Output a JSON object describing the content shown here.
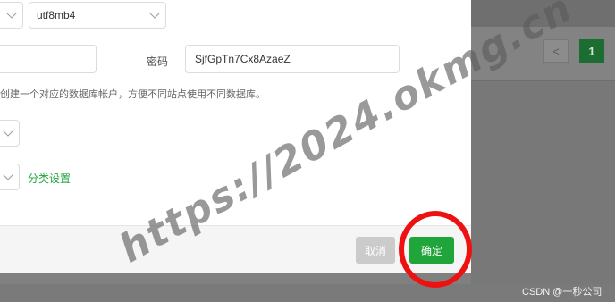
{
  "form": {
    "charset_value": "utf8mb4",
    "password_label": "密码",
    "password_value": "SjfGpTn7Cx8AzaeZ",
    "hint_text": "创建一个对应的数据库帐户，方便不同站点使用不同数据库。",
    "category_link": "分类设置"
  },
  "footer": {
    "cancel_label": "取消",
    "confirm_label": "确定"
  },
  "pagination": {
    "prev_symbol": "<",
    "current_page": "1"
  },
  "watermark": "https://2024.okmg.cn",
  "credit": "CSDN @一秒公司",
  "colors": {
    "primary_green": "#20a53a",
    "annotation_red": "#ee1111"
  }
}
